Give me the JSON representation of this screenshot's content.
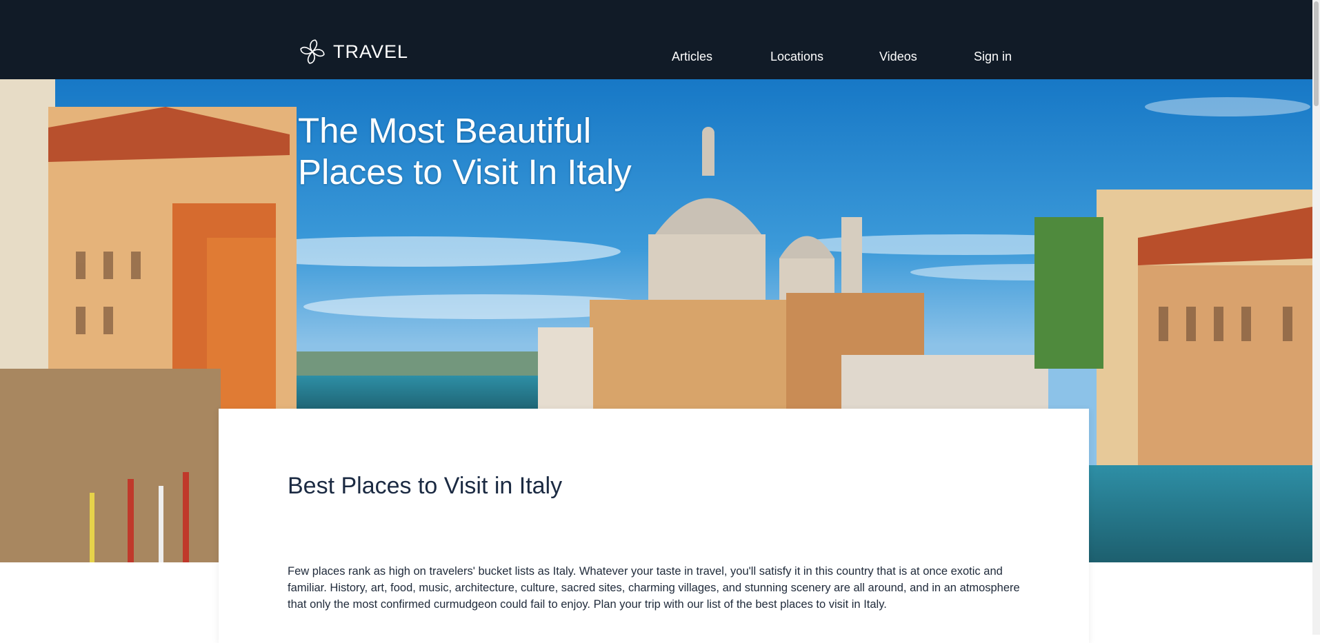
{
  "header": {
    "logo_text": "TRAVEL",
    "nav": [
      {
        "label": "Articles"
      },
      {
        "label": "Locations"
      },
      {
        "label": "Videos"
      },
      {
        "label": "Sign in"
      }
    ]
  },
  "hero": {
    "title": "The Most Beautiful Places to Visit In Italy",
    "image": "venice-grand-canal-basilica-photo"
  },
  "article": {
    "title": "Best Places to Visit in Italy",
    "body": "Few places rank as high on travelers' bucket lists as Italy. Whatever your taste in travel, you'll satisfy it in this country that is at once exotic and familiar. History, art, food, music, architecture, culture, sacred sites, charming villages, and stunning scenery are all around, and in an atmosphere that only the most confirmed curmudgeon could fail to enjoy. Plan your trip with our list of the best places to visit in Italy."
  },
  "colors": {
    "header_bg": "#111b27",
    "title_text": "#1b2a42",
    "body_text": "#1f2a3a"
  }
}
